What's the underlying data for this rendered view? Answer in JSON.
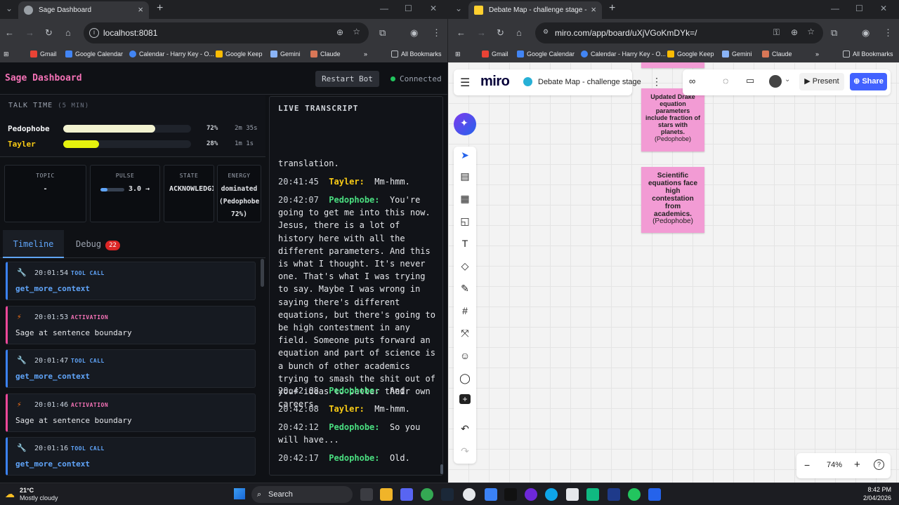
{
  "left_window": {
    "tab_title": "Sage Dashboard",
    "url": "localhost:8081",
    "bookmarks": [
      "Gmail",
      "Google Calendar",
      "Calendar - Harry Key - O...",
      "Google Keep",
      "Gemini",
      "Claude"
    ],
    "all_bookmarks": "All Bookmarks"
  },
  "right_window": {
    "tab_title": "Debate Map - challenge stage - Miro",
    "url": "miro.com/app/board/uXjVGoKmDYk=/",
    "bookmarks": [
      "Gmail",
      "Google Calendar",
      "Calendar - Harry Key - O...",
      "Google Keep",
      "Gemini",
      "Claude"
    ],
    "all_bookmarks": "All Bookmarks"
  },
  "sage": {
    "title": "Sage Dashboard",
    "restart_label": "Restart Bot",
    "status": "Connected",
    "talk_time": {
      "label": "TALK TIME",
      "window": "(5 MIN)",
      "speakers": [
        {
          "name": "Pedophobe",
          "pct_text": "72%",
          "pct": 0.72,
          "duration": "2m 35s",
          "color": "#f2f2d0"
        },
        {
          "name": "Tayler",
          "pct_text": "28%",
          "pct": 0.28,
          "duration": "1m 1s",
          "color": "#e5f20e"
        }
      ]
    },
    "stats": {
      "topic": {
        "label": "TOPIC",
        "value": "-"
      },
      "pulse": {
        "label": "PULSE",
        "value": "3.0 →",
        "level": 0.3
      },
      "state": {
        "label": "STATE",
        "value": "ACKNOWLEDGI"
      },
      "energy": {
        "label": "ENERGY",
        "value": "dominated (Pedophobe 72%)"
      }
    },
    "tabs": {
      "timeline": "Timeline",
      "debug": "Debug",
      "debug_count": "22"
    },
    "timeline": [
      {
        "time": "20:01:54",
        "kind": "TOOL CALL",
        "body": "get_more_context",
        "type": "tool"
      },
      {
        "time": "20:01:53",
        "kind": "ACTIVATION",
        "body": "Sage at sentence boundary",
        "type": "act"
      },
      {
        "time": "20:01:47",
        "kind": "TOOL CALL",
        "body": "get_more_context",
        "type": "tool"
      },
      {
        "time": "20:01:46",
        "kind": "ACTIVATION",
        "body": "Sage at sentence boundary",
        "type": "act"
      },
      {
        "time": "20:01:16",
        "kind": "TOOL CALL",
        "body": "get_more_context",
        "type": "tool"
      }
    ],
    "transcript": {
      "label": "LIVE TRANSCRIPT",
      "partial": "translation.",
      "entries": [
        {
          "time": "20:41:45",
          "speaker": "Tayler:",
          "text": "Mm-hmm."
        },
        {
          "time": "20:42:07",
          "speaker": "Pedophobe:",
          "text": "You're going to get me into this now. Jesus, there is a lot of history here with all the different parameters. And this is what I thought. It's never one. That's what I was trying to say. Maybe I was wrong in saying there's different equations, but there's going to be high contestment in any field. Someone puts forward an equation and part of science is a bunch of other academics trying to smash the shit out of your ideas to better their own careers."
        },
        {
          "time": "20:42:08",
          "speaker": "Pedophobe:",
          "text": "And"
        },
        {
          "time": "20:42:08",
          "speaker": "Tayler:",
          "text": "Mm-hmm."
        },
        {
          "time": "20:42:12",
          "speaker": "Pedophobe:",
          "text": "So you will have..."
        },
        {
          "time": "20:42:17",
          "speaker": "Pedophobe:",
          "text": "Old."
        }
      ]
    }
  },
  "miro": {
    "logo": "miro",
    "board_title": "Debate Map - challenge stage",
    "present": "Present",
    "share": "Share",
    "zoom": "74%",
    "stickies": [
      {
        "text": "Updated Drake equation parameters include fraction of stars with planets.",
        "author": "(Pedophobe)"
      },
      {
        "text": "Scientific equations face high contestation from academics.",
        "author": "(Pedophobe)"
      }
    ]
  },
  "taskbar": {
    "temp": "21°C",
    "weather": "Mostly cloudy",
    "search": "Search",
    "time": "8:42 PM",
    "date": "2/04/2026"
  }
}
